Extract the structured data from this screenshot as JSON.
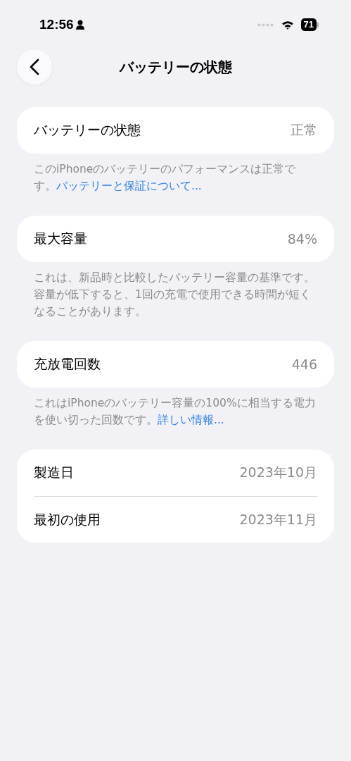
{
  "status_bar": {
    "time": "12:56",
    "battery": "71"
  },
  "nav": {
    "title": "バッテリーの状態"
  },
  "sections": [
    {
      "rows": [
        {
          "label": "バッテリーの状態",
          "value": "正常"
        }
      ],
      "footer": {
        "text": "このiPhoneのバッテリーのパフォーマンスは正常です。",
        "link": "バッテリーと保証について..."
      }
    },
    {
      "rows": [
        {
          "label": "最大容量",
          "value": "84%"
        }
      ],
      "footer": {
        "text": "これは、新品時と比較したバッテリー容量の基準です。容量が低下すると、1回の充電で使用できる時間が短くなることがあります。"
      }
    },
    {
      "rows": [
        {
          "label": "充放電回数",
          "value": "446"
        }
      ],
      "footer": {
        "text": "これはiPhoneのバッテリー容量の100%に相当する電力を使い切った回数です。",
        "link": "詳しい情報..."
      }
    },
    {
      "rows": [
        {
          "label": "製造日",
          "value": "2023年10月"
        },
        {
          "label": "最初の使用",
          "value": "2023年11月"
        }
      ]
    }
  ]
}
